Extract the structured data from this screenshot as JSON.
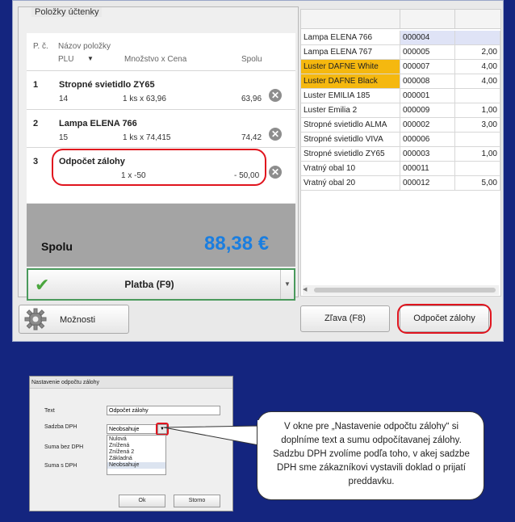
{
  "receipt": {
    "group_title": "Položky účtenky",
    "col_no": "P. č.",
    "col_name": "Názov položky",
    "col_plu": "PLU",
    "col_qty": "Množstvo x Cena",
    "col_total": "Spolu",
    "items": [
      {
        "no": "1",
        "name": "Stropné svietidlo ZY65",
        "plu": "14",
        "qty": "1 ks x 63,96",
        "total": "63,96"
      },
      {
        "no": "2",
        "name": "Lampa ELENA 766",
        "plu": "15",
        "qty": "1 ks x 74,415",
        "total": "74,42"
      },
      {
        "no": "3",
        "name": "Odpočet zálohy",
        "plu": "",
        "qty": "1  x -50",
        "total": "- 50,00"
      }
    ]
  },
  "total": {
    "label": "Spolu",
    "value": "88,38 €"
  },
  "pay": {
    "label": "Platba (F9)"
  },
  "options": {
    "label": "Možnosti"
  },
  "discount": {
    "label": "Zľava (F8)"
  },
  "deposit": {
    "label": "Odpočet zálohy"
  },
  "grid": {
    "rows": [
      {
        "name": "Lampa ELENA 766",
        "code": "000004",
        "qty": "",
        "highlight": false,
        "selected": true
      },
      {
        "name": "Lampa ELENA 767",
        "code": "000005",
        "qty": "2,00",
        "highlight": false,
        "selected": false
      },
      {
        "name": "Luster DAFNE  White",
        "code": "000007",
        "qty": "4,00",
        "highlight": true,
        "selected": false
      },
      {
        "name": "Luster DAFNE Black",
        "code": "000008",
        "qty": "4,00",
        "highlight": true,
        "selected": false
      },
      {
        "name": "Luster EMILIA 185",
        "code": "000001",
        "qty": "",
        "highlight": false,
        "selected": false
      },
      {
        "name": "Luster Emilia 2",
        "code": "000009",
        "qty": "1,00",
        "highlight": false,
        "selected": false
      },
      {
        "name": "Stropné svietidlo ALMA",
        "code": "000002",
        "qty": "3,00",
        "highlight": false,
        "selected": false
      },
      {
        "name": "Stropné svietidlo VIVA",
        "code": "000006",
        "qty": "",
        "highlight": false,
        "selected": false
      },
      {
        "name": "Stropné svietidlo ZY65",
        "code": "000003",
        "qty": "1,00",
        "highlight": false,
        "selected": false
      },
      {
        "name": "Vratný obal 10",
        "code": "000011",
        "qty": "",
        "highlight": false,
        "selected": false
      },
      {
        "name": "Vratný obal 20",
        "code": "000012",
        "qty": "5,00",
        "highlight": false,
        "selected": false
      }
    ]
  },
  "dialog": {
    "title": "Nastavenie odpočtu zálohy",
    "text_label": "Text",
    "text_value": "Odpočet zálohy",
    "vat_label": "Sadzba DPH",
    "vat_value": "Neobsahuje",
    "vat_options": [
      "Nulová",
      "Znížená",
      "Znížená 2",
      "Základná",
      "Neobsahuje"
    ],
    "net_label": "Suma bez DPH",
    "gross_label": "Suma s DPH",
    "ok_label": "Ok",
    "cancel_label": "Storno"
  },
  "callout": {
    "text": "V okne pre „Nastavenie odpočtu zálohy“ si doplníme text a sumu odpočítavanej zálohy. Sadzbu DPH zvolíme podľa toho, v akej sadzbe DPH sme zákazníkovi vystavili doklad o prijatí preddavku."
  },
  "colors": {
    "background": "#14257f",
    "accent_total": "#1a7ee0",
    "highlight_row": "#f5b80f",
    "outline_red": "#e0141e",
    "pay_border": "#4a9a5c"
  }
}
